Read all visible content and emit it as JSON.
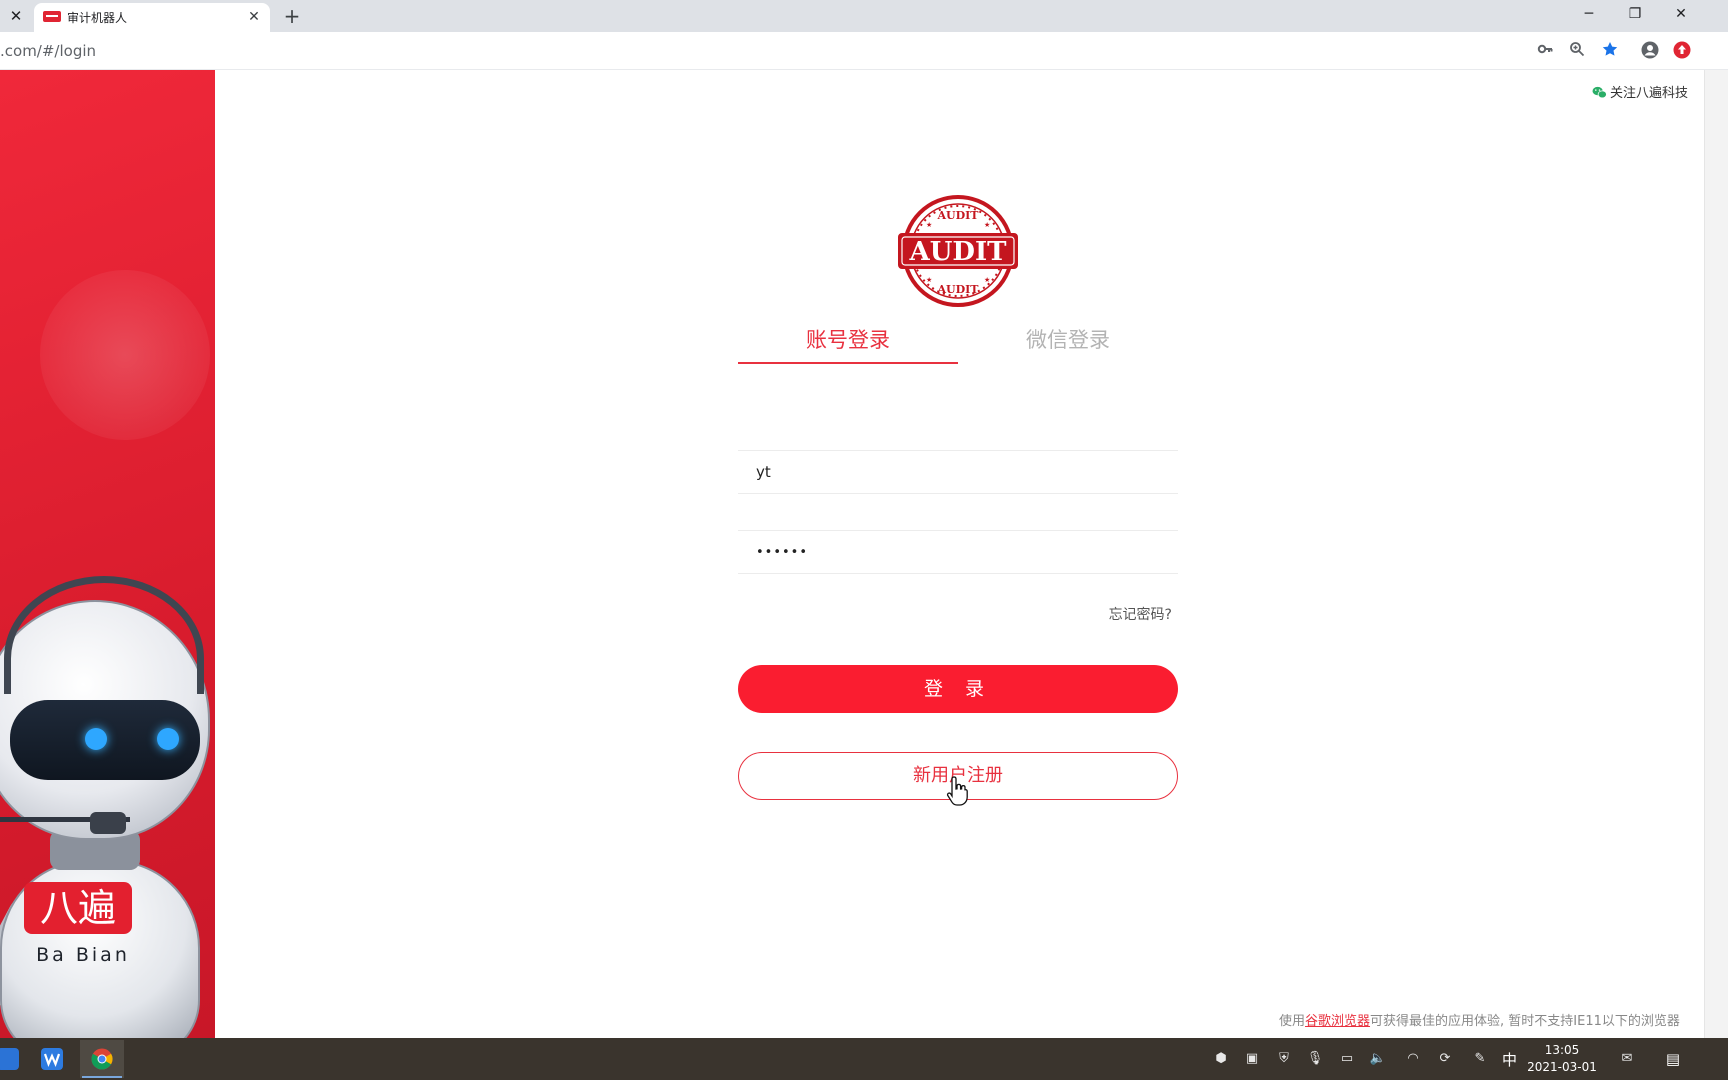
{
  "browser": {
    "tab_title": "审计机器人",
    "url": ".com/#/login",
    "new_tab_symbol": "+",
    "close_symbol": "✕"
  },
  "page": {
    "follow_link": "关注八遍科技",
    "logo": {
      "top_text": "AUDIT",
      "main_text": "AUDIT",
      "bottom_text": "AUDIT"
    },
    "robot_badge": {
      "cn": "八遍",
      "en": "Ba Bian"
    },
    "login_tabs": [
      {
        "label": "账号登录",
        "active": true
      },
      {
        "label": "微信登录",
        "active": false
      }
    ],
    "username_value": "yt",
    "password_value": "••••••",
    "forgot_password": "忘记密码?",
    "login_button": "登 录",
    "register_button": "新用户注册",
    "footer": {
      "prefix": "使用",
      "link": "谷歌浏览器",
      "suffix": "可获得最佳的应用体验, 暂时不支持IE11以下的浏览器"
    },
    "colors": {
      "brand_red": "#e8313f",
      "button_red": "#fa1d30",
      "panel_red": "#d81c2d"
    }
  },
  "taskbar": {
    "time": "13:05",
    "date": "2021-03-01",
    "ime": "中",
    "apps": [
      "app-icon",
      "wps-icon",
      "chrome-icon"
    ]
  }
}
